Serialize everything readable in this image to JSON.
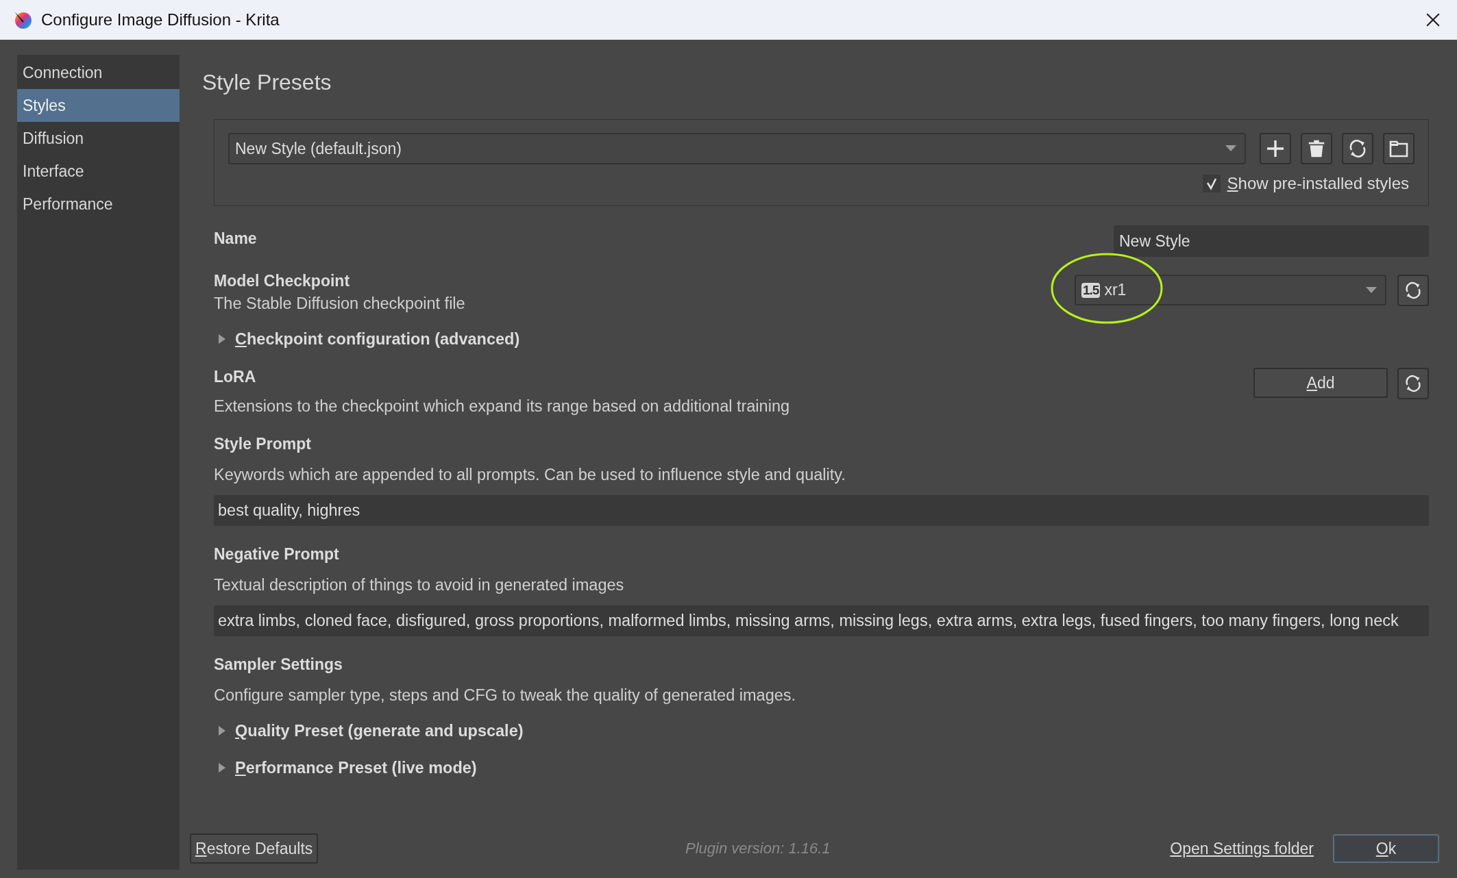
{
  "window": {
    "title": "Configure Image Diffusion - Krita"
  },
  "sidebar": {
    "items": [
      {
        "label": "Connection",
        "selected": false
      },
      {
        "label": "Styles",
        "selected": true
      },
      {
        "label": "Diffusion",
        "selected": false
      },
      {
        "label": "Interface",
        "selected": false
      },
      {
        "label": "Performance",
        "selected": false
      }
    ]
  },
  "page_title": "Style Presets",
  "preset": {
    "value": "New Style (default.json)",
    "show_preinstalled": {
      "label": "Show pre-installed styles",
      "checked": true
    }
  },
  "settings": [
    {
      "kind": "name",
      "title": "Name",
      "value": "New Style"
    },
    {
      "kind": "checkpoint",
      "title": "Model Checkpoint",
      "description": "The Stable Diffusion checkpoint file",
      "badge": "1.5",
      "value": "xr1"
    },
    {
      "kind": "expander",
      "label": "Checkpoint configuration (advanced)",
      "expanded": false
    },
    {
      "kind": "lora",
      "title": "LoRA",
      "description": "Extensions to the checkpoint which expand its range based on additional training",
      "button": "Add"
    },
    {
      "kind": "prompt",
      "title": "Style Prompt",
      "description": "Keywords which are appended to all prompts. Can be used to influence style and quality.",
      "value": "best quality, highres"
    },
    {
      "kind": "prompt",
      "title": "Negative Prompt",
      "description": "Textual description of things to avoid in generated images",
      "value": "extra limbs, cloned face, disfigured, gross proportions, malformed limbs, missing arms, missing legs, extra arms, extra legs, fused fingers, too many fingers, long neck"
    },
    {
      "kind": "heading",
      "title": "Sampler Settings",
      "description": "Configure sampler type, steps and CFG to tweak the quality of generated images."
    },
    {
      "kind": "expander",
      "label": "Quality Preset (generate and upscale)",
      "expanded": false
    },
    {
      "kind": "expander",
      "label": "Performance Preset (live mode)",
      "expanded": false
    }
  ],
  "footer": {
    "restore": "Restore Defaults",
    "version": "Plugin version: 1.16.1",
    "open_folder": "Open Settings folder",
    "ok": "Ok"
  }
}
